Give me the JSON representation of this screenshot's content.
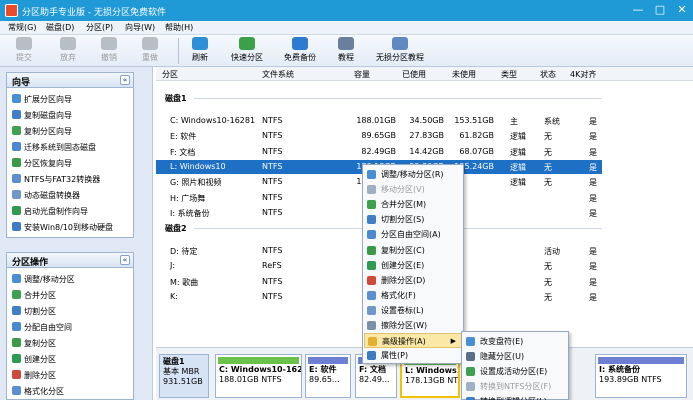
{
  "window": {
    "title": "分区助手专业版 - 无损分区免费软件",
    "min": "—",
    "max": "□",
    "close": "✕"
  },
  "menu": [
    "常规(G)",
    "磁盘(D)",
    "分区(P)",
    "向导(W)",
    "帮助(H)"
  ],
  "toolbar": {
    "commit": "提交",
    "discard": "放弃",
    "undo": "撤销",
    "redo": "重做",
    "refresh": "刷新",
    "quick_partition": "快速分区",
    "free_backup": "免费备份",
    "tutorial": "教程",
    "lossless_tutorial": "无损分区教程"
  },
  "wizard_panel": {
    "title": "向导",
    "collapse": "«",
    "items": [
      "扩展分区向导",
      "复制磁盘向导",
      "复制分区向导",
      "迁移系统到固态磁盘",
      "分区恢复向导",
      "NTFS与FAT32转换器",
      "动态磁盘转换器",
      "启动光盘制作向导",
      "安装Win8/10到移动硬盘"
    ]
  },
  "ops_panel": {
    "title": "分区操作",
    "collapse": "«",
    "items": [
      "调整/移动分区",
      "合并分区",
      "切割分区",
      "分配自由空间",
      "复制分区",
      "创建分区",
      "删除分区",
      "格式化分区"
    ]
  },
  "columns": [
    "分区",
    "文件系统",
    "容量",
    "已使用",
    "未使用",
    "类型",
    "状态",
    "4K对齐"
  ],
  "disks": [
    {
      "label": "磁盘1",
      "rows": [
        [
          "C: Windows10-16281",
          "NTFS",
          "188.01GB",
          "34.50GB",
          "153.51GB",
          "主",
          "系统",
          "是"
        ],
        [
          "E: 软件",
          "NTFS",
          "89.65GB",
          "27.83GB",
          "61.82GB",
          "逻辑",
          "无",
          "是"
        ],
        [
          "F: 文档",
          "NTFS",
          "82.49GB",
          "14.42GB",
          "68.07GB",
          "逻辑",
          "无",
          "是"
        ],
        [
          "L: Windows10",
          "NTFS",
          "178.13GB",
          "52.89GB",
          "125.24GB",
          "逻辑",
          "无",
          "是"
        ],
        [
          "G: 照片和视频",
          "NTFS",
          "120.57GB",
          "",
          "",
          "逻辑",
          "无",
          "是"
        ],
        [
          "H: 广场舞",
          "NTFS",
          "120.9",
          "",
          "",
          "",
          "",
          "是"
        ],
        [
          "I: 系统备份",
          "NTFS",
          "193.8",
          "",
          "",
          "",
          "",
          "是"
        ]
      ]
    },
    {
      "label": "磁盘2",
      "rows": [
        [
          "D: 待定",
          "NTFS",
          "200.3",
          "",
          "",
          "",
          "活动",
          "是"
        ],
        [
          "J:",
          "ReFS",
          "100.6",
          "",
          "",
          "",
          "无",
          "是"
        ],
        [
          "M: 歌曲",
          "NTFS",
          "100.6",
          "",
          "",
          "",
          "无",
          "是"
        ],
        [
          "K:",
          "NTFS",
          "64.5",
          "",
          "",
          "",
          "无",
          "是"
        ]
      ]
    }
  ],
  "disk_map": {
    "disk_name": "磁盘1",
    "disk_type": "基本 MBR",
    "disk_size": "931.51GB",
    "partitions": [
      {
        "name": "C: Windows10-16281",
        "info": "188.01GB NTFS"
      },
      {
        "name": "E: 软件",
        "info": "89.65..."
      },
      {
        "name": "F: 文档",
        "info": "82.49..."
      },
      {
        "name": "L: Windows10",
        "info": "178.13GB NTFS"
      },
      {
        "name": "I: 系统备份",
        "info": "193.89GB NTFS"
      }
    ]
  },
  "context_menu": {
    "items": [
      "调整/移动分区(R)",
      "移动分区(V)",
      "合并分区(M)",
      "切割分区(S)",
      "分区自由空间(A)",
      "复制分区(C)",
      "创建分区(E)",
      "删除分区(D)",
      "格式化(F)",
      "设置卷标(L)",
      "擦除分区(W)",
      "高级操作(A)",
      "属性(P)"
    ]
  },
  "submenu": {
    "items": [
      "改变盘符(E)",
      "隐藏分区(U)",
      "设置成活动分区(E)",
      "转换到NTFS分区(F)",
      "转换到逻辑分区(L)"
    ]
  }
}
